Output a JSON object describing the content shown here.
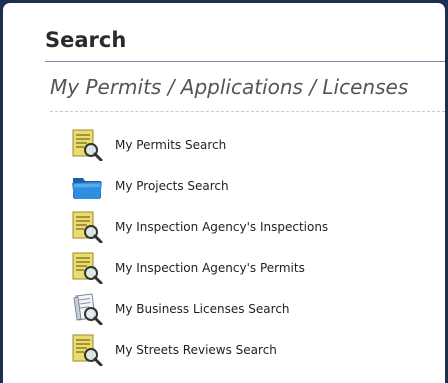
{
  "search": {
    "title": "Search",
    "subtitle": "My Permits / Applications / Licenses",
    "items": [
      {
        "label": "My Permits Search",
        "icon": "document-search-icon"
      },
      {
        "label": "My Projects Search",
        "icon": "folder-icon"
      },
      {
        "label": "My Inspection Agency's Inspections",
        "icon": "document-search-icon"
      },
      {
        "label": "My Inspection Agency's Permits",
        "icon": "document-search-icon"
      },
      {
        "label": "My Business Licenses Search",
        "icon": "license-search-icon"
      },
      {
        "label": "My Streets Reviews Search",
        "icon": "document-search-icon"
      }
    ]
  },
  "colors": {
    "frame": "#1c2d52",
    "panel": "#ffffff",
    "document_icon": "#e9d96a",
    "folder_icon": "#2a7fd0"
  }
}
